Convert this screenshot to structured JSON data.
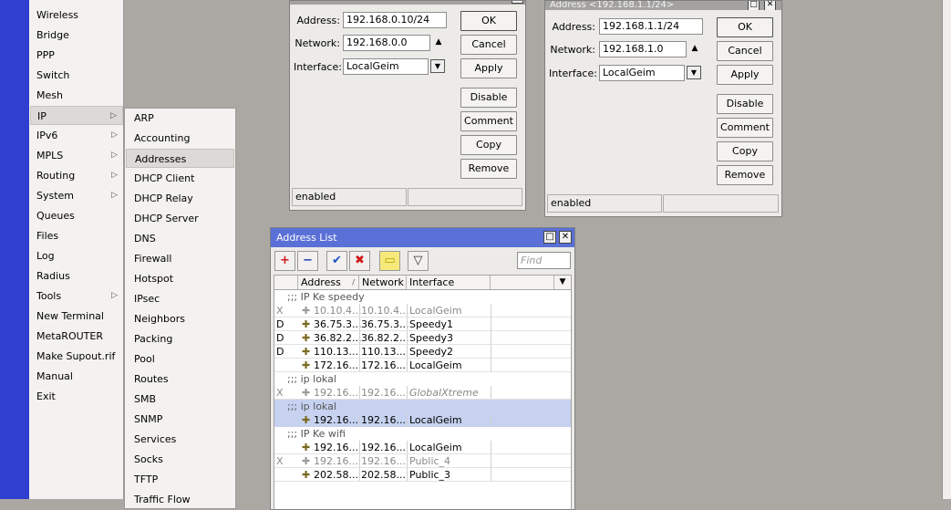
{
  "main_menu": {
    "items": [
      {
        "label": "Wireless",
        "arrow": ""
      },
      {
        "label": "Bridge",
        "arrow": ""
      },
      {
        "label": "PPP",
        "arrow": ""
      },
      {
        "label": "Switch",
        "arrow": ""
      },
      {
        "label": "Mesh",
        "arrow": ""
      },
      {
        "label": "IP",
        "arrow": "▷"
      },
      {
        "label": "IPv6",
        "arrow": "▷"
      },
      {
        "label": "MPLS",
        "arrow": "▷"
      },
      {
        "label": "Routing",
        "arrow": "▷"
      },
      {
        "label": "System",
        "arrow": "▷"
      },
      {
        "label": "Queues",
        "arrow": ""
      },
      {
        "label": "Files",
        "arrow": ""
      },
      {
        "label": "Log",
        "arrow": ""
      },
      {
        "label": "Radius",
        "arrow": ""
      },
      {
        "label": "Tools",
        "arrow": "▷"
      },
      {
        "label": "New Terminal",
        "arrow": ""
      },
      {
        "label": "MetaROUTER",
        "arrow": ""
      },
      {
        "label": "Make Supout.rif",
        "arrow": ""
      },
      {
        "label": "Manual",
        "arrow": ""
      },
      {
        "label": "Exit",
        "arrow": ""
      }
    ]
  },
  "ip_submenu": {
    "items": [
      "ARP",
      "Accounting",
      "Addresses",
      "DHCP Client",
      "DHCP Relay",
      "DHCP Server",
      "DNS",
      "Firewall",
      "Hotspot",
      "IPsec",
      "Neighbors",
      "Packing",
      "Pool",
      "Routes",
      "SMB",
      "SNMP",
      "Services",
      "Socks",
      "TFTP",
      "Traffic Flow"
    ]
  },
  "dialog1": {
    "address_label": "Address:",
    "address_value": "192.168.0.10/24",
    "network_label": "Network:",
    "network_value": "192.168.0.0",
    "interface_label": "Interface:",
    "interface_value": "LocalGeim",
    "spin_glyph": "▲",
    "dropdown_glyph": "▼",
    "ok_label": "OK",
    "cancel_label": "Cancel",
    "apply_label": "Apply",
    "disable_label": "Disable",
    "comment_label": "Comment",
    "copy_label": "Copy",
    "remove_label": "Remove",
    "status": "enabled"
  },
  "dialog2": {
    "title": "Address <192.168.1.1/24>",
    "address_label": "Address:",
    "address_value": "192.168.1.1/24",
    "network_label": "Network:",
    "network_value": "192.168.1.0",
    "interface_label": "Interface:",
    "interface_value": "LocalGeim",
    "spin_glyph": "▲",
    "dropdown_glyph": "▼",
    "ok_label": "OK",
    "cancel_label": "Cancel",
    "apply_label": "Apply",
    "disable_label": "Disable",
    "comment_label": "Comment",
    "copy_label": "Copy",
    "remove_label": "Remove",
    "status": "enabled"
  },
  "address_list": {
    "title": "Address List",
    "find_placeholder": "Find",
    "columns": {
      "address": "Address",
      "network": "Network",
      "interface": "Interface"
    },
    "sort_glyph": "/",
    "toolbar": {
      "add": "+",
      "remove": "−",
      "enable": "✔",
      "disable": "✖",
      "comment": "▭",
      "filter": "▽"
    },
    "comment_rows": [
      ";;; IP Ke speedy",
      ";;; ip lokal",
      ";;; ip lokal",
      ";;; IP Ke wifi"
    ],
    "rows": [
      {
        "flag": "X",
        "address": "10.10.4...",
        "network": "10.10.4...",
        "interface": "LocalGeim"
      },
      {
        "flag": "D",
        "address": "36.75.3...",
        "network": "36.75.3...",
        "interface": "Speedy1"
      },
      {
        "flag": "D",
        "address": "36.82.2...",
        "network": "36.82.2...",
        "interface": "Speedy3"
      },
      {
        "flag": "D",
        "address": "110.13...",
        "network": "110.13...",
        "interface": "Speedy2"
      },
      {
        "flag": "",
        "address": "172.16...",
        "network": "172.16...",
        "interface": "LocalGeim"
      },
      {
        "flag": "X",
        "address": "192.16...",
        "network": "192.16...",
        "interface": "GlobalXtreme"
      },
      {
        "flag": "",
        "address": "192.16...",
        "network": "192.16...",
        "interface": "LocalGeim"
      },
      {
        "flag": "",
        "address": "192.16...",
        "network": "192.16...",
        "interface": "LocalGeim"
      },
      {
        "flag": "X",
        "address": "192.16...",
        "network": "192.16...",
        "interface": "Public_4"
      },
      {
        "flag": "",
        "address": "202.58...",
        "network": "202.58...",
        "interface": "Public_3"
      }
    ]
  },
  "icons": {
    "address_row": "plus-sign-icon",
    "minimize": "□",
    "close": "✕",
    "column_menu": "▼"
  },
  "colors": {
    "accent_title": "#5a70d6",
    "selected_row": "#c6d2f0",
    "menu_strip": "#2f3fd0"
  }
}
